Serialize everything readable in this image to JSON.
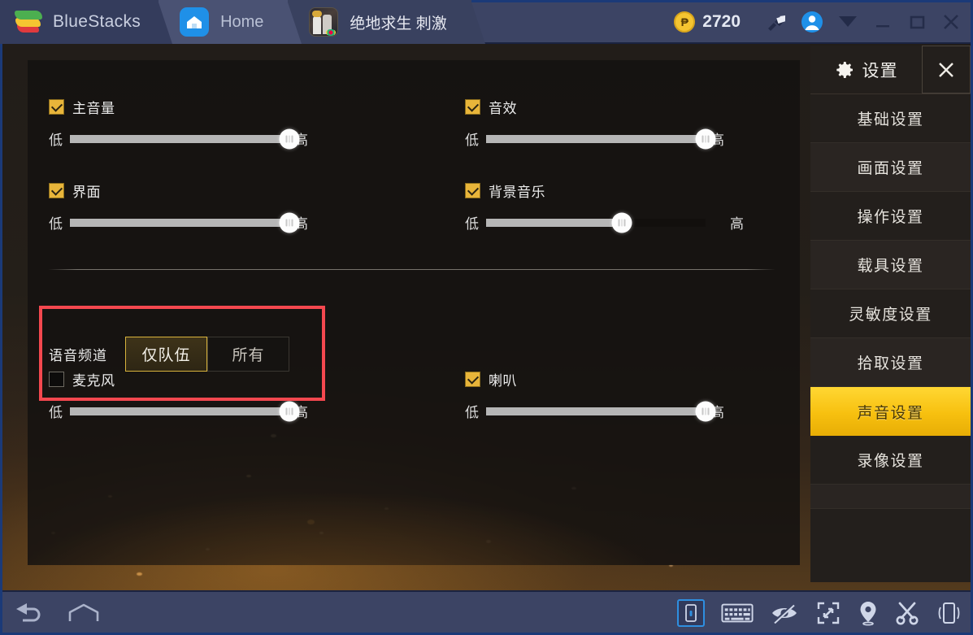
{
  "titlebar": {
    "brand": "BlueStacks",
    "tabs": [
      {
        "label": "Home",
        "icon": "home-icon"
      },
      {
        "label": "绝地求生 刺激",
        "icon": "game-app-icon"
      }
    ],
    "coins": "2720",
    "icons": [
      "coin-icon",
      "brush-icon",
      "account-avatar-icon",
      "chevron-down-icon",
      "minimize-icon",
      "maximize-icon",
      "close-icon"
    ]
  },
  "settings_panel": {
    "title": "设置",
    "close_label": "✕",
    "items": [
      {
        "label": "基础设置",
        "active": false
      },
      {
        "label": "画面设置",
        "active": false
      },
      {
        "label": "操作设置",
        "active": false
      },
      {
        "label": "载具设置",
        "active": false
      },
      {
        "label": "灵敏度设置",
        "active": false
      },
      {
        "label": "拾取设置",
        "active": false
      },
      {
        "label": "声音设置",
        "active": true
      },
      {
        "label": "录像设置",
        "active": false
      }
    ]
  },
  "sound_settings": {
    "slider_low": "低",
    "slider_high": "高",
    "controls": [
      {
        "name": "master-volume",
        "label": "主音量",
        "checked": true,
        "value": 100
      },
      {
        "name": "sound-effects",
        "label": "音效",
        "checked": true,
        "value": 100
      },
      {
        "name": "interface",
        "label": "界面",
        "checked": true,
        "value": 100
      },
      {
        "name": "background-music",
        "label": "背景音乐",
        "checked": true,
        "value": 62
      },
      {
        "name": "microphone",
        "label": "麦克风",
        "checked": false,
        "value": 100
      },
      {
        "name": "speaker",
        "label": "喇叭",
        "checked": true,
        "value": 100
      }
    ],
    "voice_channel": {
      "label": "语音频道",
      "options": [
        {
          "label": "仅队伍",
          "selected": true
        },
        {
          "label": "所有",
          "selected": false
        }
      ]
    },
    "highlight_color": "#f4484f"
  },
  "bottombar": {
    "left_icons": [
      "back-icon",
      "home-nav-icon"
    ],
    "right_icons": [
      "phone-portrait-icon",
      "keyboard-icon",
      "eye-slash-icon",
      "fullscreen-icon",
      "location-pin-icon",
      "scissors-icon",
      "shake-device-icon"
    ]
  },
  "colors": {
    "accent_yellow": "#f7c00f",
    "titlebar": "#3c4464",
    "panel_bg": "#231f1c",
    "highlight_red": "#f4484f",
    "blue_frame": "#1b3a78"
  }
}
